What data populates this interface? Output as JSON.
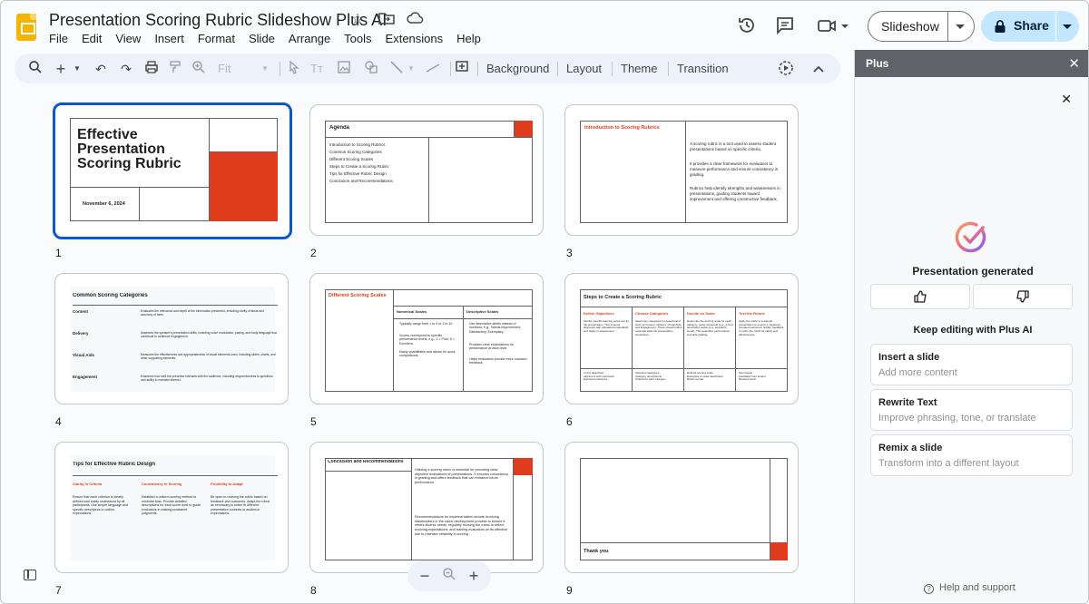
{
  "app": {
    "title": "Presentation Scoring Rubric Slideshow Plus AI",
    "menu": [
      "File",
      "Edit",
      "View",
      "Insert",
      "Format",
      "Slide",
      "Arrange",
      "Tools",
      "Extensions",
      "Help"
    ],
    "slideshow_label": "Slideshow",
    "share_label": "Share",
    "icons": [
      "star-icon",
      "move-to-folder-icon",
      "cloud-status-icon",
      "history-icon",
      "comments-icon",
      "meet-camera-icon"
    ]
  },
  "toolbar": {
    "zoom_value": "Fit",
    "background_label": "Background",
    "layout_label": "Layout",
    "theme_label": "Theme",
    "transition_label": "Transition"
  },
  "slides": {
    "s1": {
      "num": "1",
      "title": "Effective Presentation Scoring Rubric",
      "date": "November 6, 2024"
    },
    "s2": {
      "num": "2",
      "title": "Agenda",
      "items": [
        "Introduction to Scoring Rubrics",
        "Common Scoring Categories",
        "Different Scoring Scales",
        "Steps to Create a Scoring Rubric",
        "Tips for Effective Rubric Design",
        "Conclusion and Recommendations"
      ]
    },
    "s3": {
      "num": "3",
      "title": "Introduction to Scoring Rubrics",
      "p1": "A scoring rubric is a tool used to assess student presentations based on specific criteria.",
      "p2": "It provides a clear framework for evaluators to measure performance and ensure consistency in grading.",
      "p3": "Rubrics help identify strengths and weaknesses in presentations, guiding students toward improvement and offering constructive feedback."
    },
    "s4": {
      "num": "4",
      "title": "Common Scoring Categories",
      "rows": [
        {
          "k": "Content",
          "v": "Evaluates the relevance and depth of the information presented, including clarity of ideas and accuracy of facts."
        },
        {
          "k": "Delivery",
          "v": "Assesses the speaker's presentation skills, including voice modulation, pacing, and body language that contribute to audience engagement."
        },
        {
          "k": "Visual Aids",
          "v": "Measures the effectiveness and appropriateness of visual elements used, including slides, charts, and other supporting elements."
        },
        {
          "k": "Engagement",
          "v": "Examines how well the presenter interacts with the audience, including responsiveness to questions and ability to maintain interest."
        }
      ]
    },
    "s5": {
      "num": "5",
      "title": "Different Scoring Scales",
      "col1": "Numerical Scales",
      "col2": "Descriptive Scales",
      "col1_items": [
        "Typically range from 1 to 5 or 1 to 10.",
        "Scores correspond to specific performance levels, e.g., 1 = Poor, 5 = Excellent.",
        "Easily quantifiable and allows for quick comparisons."
      ],
      "col2_items": [
        "Use descriptive labels instead of numbers, e.g., Needs Improvement, Satisfactory, Exemplary.",
        "Provides clear expectations for performance at each level.",
        "Helps evaluators provide more nuanced feedback."
      ]
    },
    "s6": {
      "num": "6",
      "title": "Steps to Create a Scoring Rubric",
      "heads": [
        "Define Objectives",
        "Choose Categories",
        "Decide on Scale",
        "Test the Rubric"
      ],
      "bodies": [
        "Identify specific learning outcomes for the presentation. This ensures alignment with educational standards and clarity in assessment.",
        "Select key categories for assessment, such as Content, Delivery, Visual Aids, and Engagement. These should reflect essential skills the presentation showcases.",
        "Determine the scoring scale for each category, using numerical (e.g., 1-5) or descriptive levels (e.g., Excellent, Good). This quantifies performance and aids grading.",
        "Apply the rubric to a sample presentation to ensure it measures intended outcomes. Gather feedback to refine the rubric for clarity and effectiveness."
      ],
      "foot": [
        "List of objectives\nAlignment with curriculum\nExpected outcomes",
        "Selected categories\nCategory descriptions\nCriteria for each category",
        "Defined scoring scale\nExamples of scale descriptors\nRubric format",
        "Test results\nFeedback from testers\nRevised rubric"
      ]
    },
    "s7": {
      "num": "7",
      "title": "Tips for Effective Rubric Design",
      "heads": [
        "Clarity in Criteria",
        "Consistency in Scoring",
        "Flexibility to Adapt"
      ],
      "bodies": [
        "Ensure that each criterion is clearly defined and easily understood by all participants. Use simple language and specific descriptors to outline expectations.",
        "Establish a uniform scoring method to minimize bias. Provide detailed descriptions for each score level to guide evaluators in making consistent judgments.",
        "Be open to revising the rubric based on feedback and outcomes. Adapt the rubric as necessary to better fit different presentation contexts or audience expectations."
      ]
    },
    "s8": {
      "num": "8",
      "title": "Conclusion and Recommendations",
      "p1": "Utilizing a scoring rubric is essential for providing clear, objective evaluations of presentations. It ensures consistency in grading and offers feedback that can enhance future performance.",
      "p2": "Recommendations for implementation include involving stakeholders in the rubric development process to ensure it meets diverse needs, regularly revising the rubric to reflect evolving expectations, and training evaluators on its effective use to maintain reliability in scoring."
    },
    "s9": {
      "num": "9",
      "title": "Thank you"
    }
  },
  "panel": {
    "title": "Plus",
    "status": "Presentation generated",
    "keep_editing": "Keep editing with Plus AI",
    "cards": [
      {
        "title": "Insert a slide",
        "subtitle": "Add more content"
      },
      {
        "title": "Rewrite Text",
        "subtitle": "Improve phrasing, tone, or translate"
      },
      {
        "title": "Remix a slide",
        "subtitle": "Transform into a different layout"
      }
    ],
    "help": "Help and support"
  },
  "colors": {
    "accent_red": "#df3b1d",
    "selected_blue": "#0b57d0",
    "share_bg": "#c2e7ff"
  }
}
